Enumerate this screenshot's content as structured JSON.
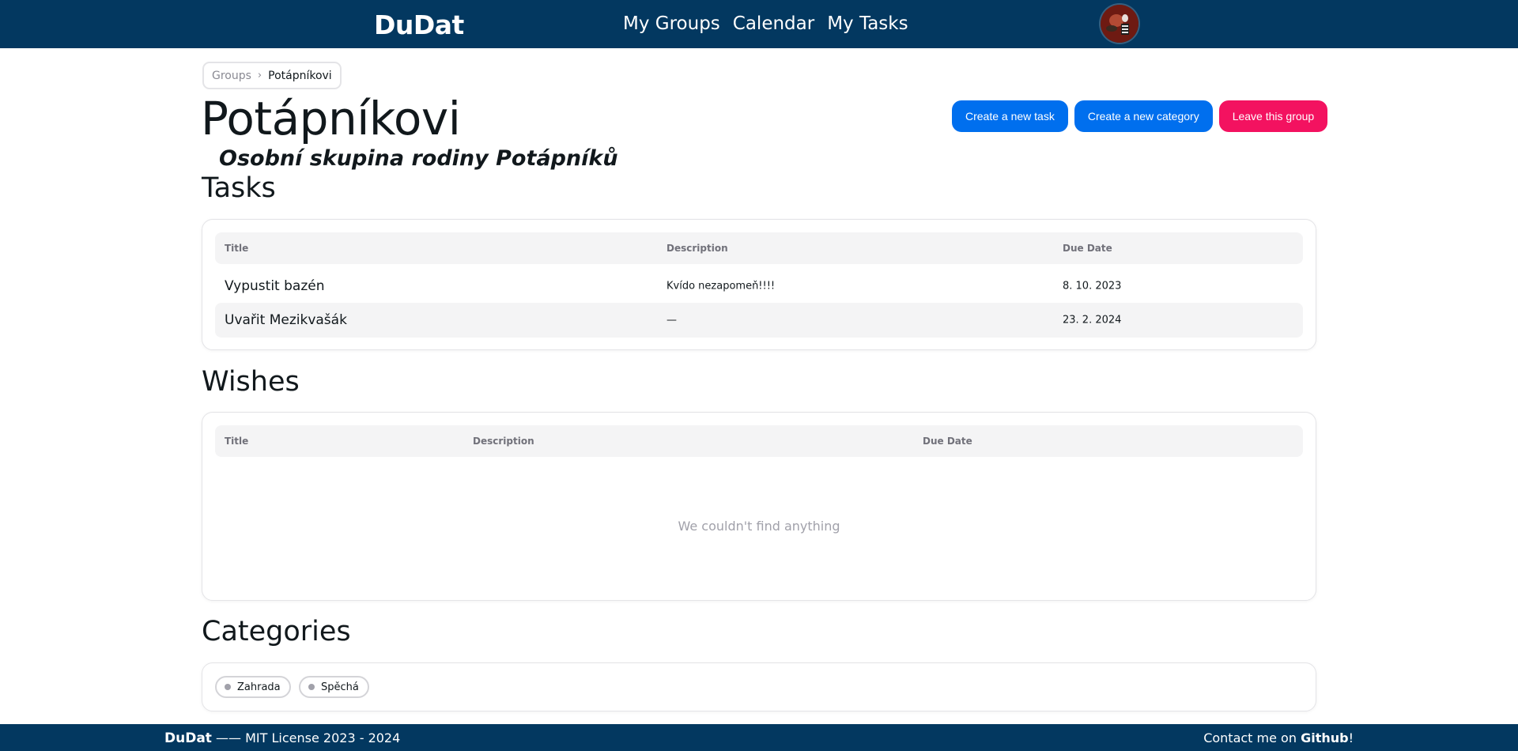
{
  "header": {
    "brand": "DuDat",
    "nav": [
      "My Groups",
      "Calendar",
      "My Tasks"
    ]
  },
  "breadcrumb": {
    "items": [
      "Groups",
      "Potápníkovi"
    ],
    "separator": "›"
  },
  "group": {
    "title": "Potápníkovi",
    "subtitle": "Osobní skupina rodiny Potápníků"
  },
  "actions": {
    "create_task": "Create a new task",
    "create_category": "Create a new category",
    "leave_group": "Leave this group"
  },
  "tasks": {
    "heading": "Tasks",
    "columns": [
      "Title",
      "Description",
      "Due Date"
    ],
    "rows": [
      {
        "title": "Vypustit bazén",
        "description": "Kvído nezapomeň!!!!",
        "due": "8. 10. 2023"
      },
      {
        "title": "Uvařit Mezikvašák",
        "description": "—",
        "due": "23. 2. 2024"
      }
    ]
  },
  "wishes": {
    "heading": "Wishes",
    "columns": [
      "Title",
      "Description",
      "Due Date"
    ],
    "empty_text": "We couldn't find anything"
  },
  "categories": {
    "heading": "Categories",
    "items": [
      "Zahrada",
      "Spěchá"
    ]
  },
  "footer": {
    "brand": "DuDat",
    "license": "—— MIT License 2023 - 2024",
    "contact_prefix": "Contact me on",
    "contact_link": "Github",
    "contact_suffix": "!"
  },
  "colors": {
    "navbar": "#033860",
    "primary": "#006fee",
    "danger": "#f31260"
  },
  "icons": {
    "avatar": "user-avatar",
    "breadcrumb_separator": "chevron-right-icon",
    "chip_dot": "dot-icon"
  }
}
